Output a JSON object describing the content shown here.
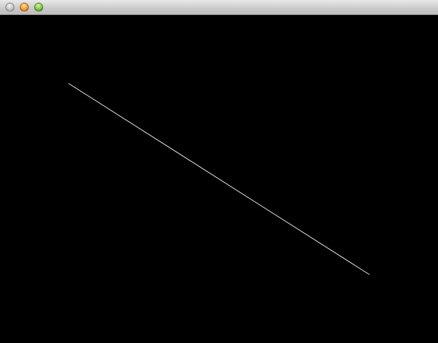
{
  "window": {
    "title": ""
  },
  "canvas": {
    "background_color": "#000000",
    "line_color": "#dff5f2"
  }
}
